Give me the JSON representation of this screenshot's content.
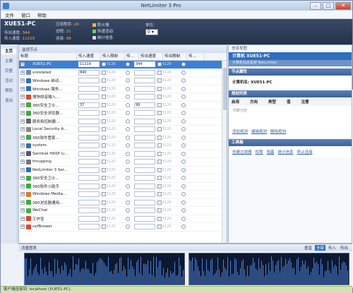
{
  "window": {
    "title": "NetLimiter 3 Pro",
    "min": "–",
    "max": "□",
    "close": "✕"
  },
  "menu": [
    "文件",
    "窗口",
    "帮助"
  ],
  "header": {
    "host": "XUE51-PC",
    "stats": [
      {
        "label": "传出速度:",
        "value": "344"
      },
      {
        "label": "传入速度:",
        "value": "11219"
      }
    ],
    "counts": [
      {
        "label": "应用程序:",
        "value": "24"
      },
      {
        "label": "进程:",
        "value": "21"
      },
      {
        "label": "连接:",
        "value": "98"
      }
    ],
    "legend": [
      {
        "label": "防火墙",
        "color": "#f3b24b"
      },
      {
        "label": "传递活动",
        "color": "#6fd06f"
      },
      {
        "label": "统计信息",
        "color": "#d8d8d8"
      }
    ],
    "unit_label": "单位:",
    "unit_value": "0"
  },
  "leftnav": [
    "主页",
    "主要",
    "完整",
    "活动",
    "帮助",
    "退出"
  ],
  "center": {
    "title": "监视节点",
    "views": [
      "全部",
      "我机",
      "高级",
      "隐藏"
    ],
    "columns": [
      "标题",
      "传入速度",
      "传入限制",
      "传…",
      "传出速度",
      "传出限制",
      "传…"
    ],
    "rows": [
      {
        "name": "XUE51-PC",
        "in": "11219",
        "out": "344",
        "lim": "5120",
        "color": "#3b7fd0",
        "selected": true
      },
      {
        "name": "unrelated",
        "in": "840",
        "out": "",
        "lim": "5120",
        "color": "#7a8aa6"
      },
      {
        "name": "Windows 启动...",
        "in": "",
        "out": "",
        "lim": "5120",
        "color": "#2f6ec0"
      },
      {
        "name": "Windows 服务...",
        "in": "",
        "out": "",
        "lim": "5120",
        "color": "#2f6ec0"
      },
      {
        "name": "搜狗拼音输入...",
        "in": "",
        "out": "",
        "lim": "5120",
        "color": "#e0452f"
      },
      {
        "name": "360安全卫士...",
        "in": "37",
        "out": "99",
        "lim": "5120",
        "color": "#3fa93f"
      },
      {
        "name": "360安全浏览器...",
        "in": "",
        "out": "",
        "lim": "5120",
        "color": "#3fa93f"
      },
      {
        "name": "服务和控制器...",
        "in": "",
        "out": "",
        "lim": "5120",
        "color": "#666"
      },
      {
        "name": "Local Security A...",
        "in": "",
        "out": "",
        "lim": "5120",
        "color": "#888"
      },
      {
        "name": "360软件管家...",
        "in": "",
        "out": "",
        "lim": "5120",
        "color": "#3fa93f"
      },
      {
        "name": "system",
        "in": "",
        "out": "",
        "lim": "5120",
        "color": "#2f6ec0"
      },
      {
        "name": "Sentinel HASP Li...",
        "in": "",
        "out": "",
        "lim": "5120",
        "color": "#556"
      },
      {
        "name": "thrupping",
        "in": "",
        "out": "",
        "lim": "5120",
        "color": "#777"
      },
      {
        "name": "NetLimiter 3 Ser...",
        "in": "",
        "out": "",
        "lim": "5120",
        "color": "#2f6ec0"
      },
      {
        "name": "360安全卫士...",
        "in": "",
        "out": "",
        "lim": "5120",
        "color": "#3fa93f"
      },
      {
        "name": "360软件小助手",
        "in": "",
        "out": "",
        "lim": "5120",
        "color": "#3fa93f"
      },
      {
        "name": "Windows Media...",
        "in": "",
        "out": "",
        "lim": "5120",
        "color": "#e07a1f"
      },
      {
        "name": "360浏览器通用...",
        "in": "",
        "out": "",
        "lim": "5120",
        "color": "#3fa93f"
      },
      {
        "name": "WeChat",
        "in": "",
        "out": "",
        "lim": "5120",
        "color": "#3fb33f"
      },
      {
        "name": "工作宝",
        "in": "",
        "out": "",
        "lim": "5120",
        "color": "#e0452f"
      },
      {
        "name": "cefBrower",
        "in": "",
        "out": "",
        "lim": "5120",
        "color": "#e0452f"
      }
    ]
  },
  "right": {
    "title": "信息视图",
    "host_label": "计算机 XUE51-PC",
    "host_sub": "计算机信息是使 NetLimiter.",
    "sec_props": "节点属性",
    "prop_name": "计算机名: XUE51-PC",
    "sec_rules": "规则列表",
    "rule_cols": [
      "启用",
      "方向",
      "类型",
      "值",
      "注意"
    ],
    "rules_empty": "列表为空",
    "rule_links": [
      "添加规则",
      "编辑规则",
      "删除规则"
    ],
    "sec_tools": "工具箱",
    "tool_links": [
      "创建过滤器",
      "权限",
      "阻塞",
      "统计信息",
      "终止连接"
    ]
  },
  "bottom": {
    "title": "流量图表",
    "views": [
      "垂直",
      "全部",
      "传入",
      "传出"
    ]
  },
  "status": "客户端连接到: localhost (XUE51-PC)."
}
